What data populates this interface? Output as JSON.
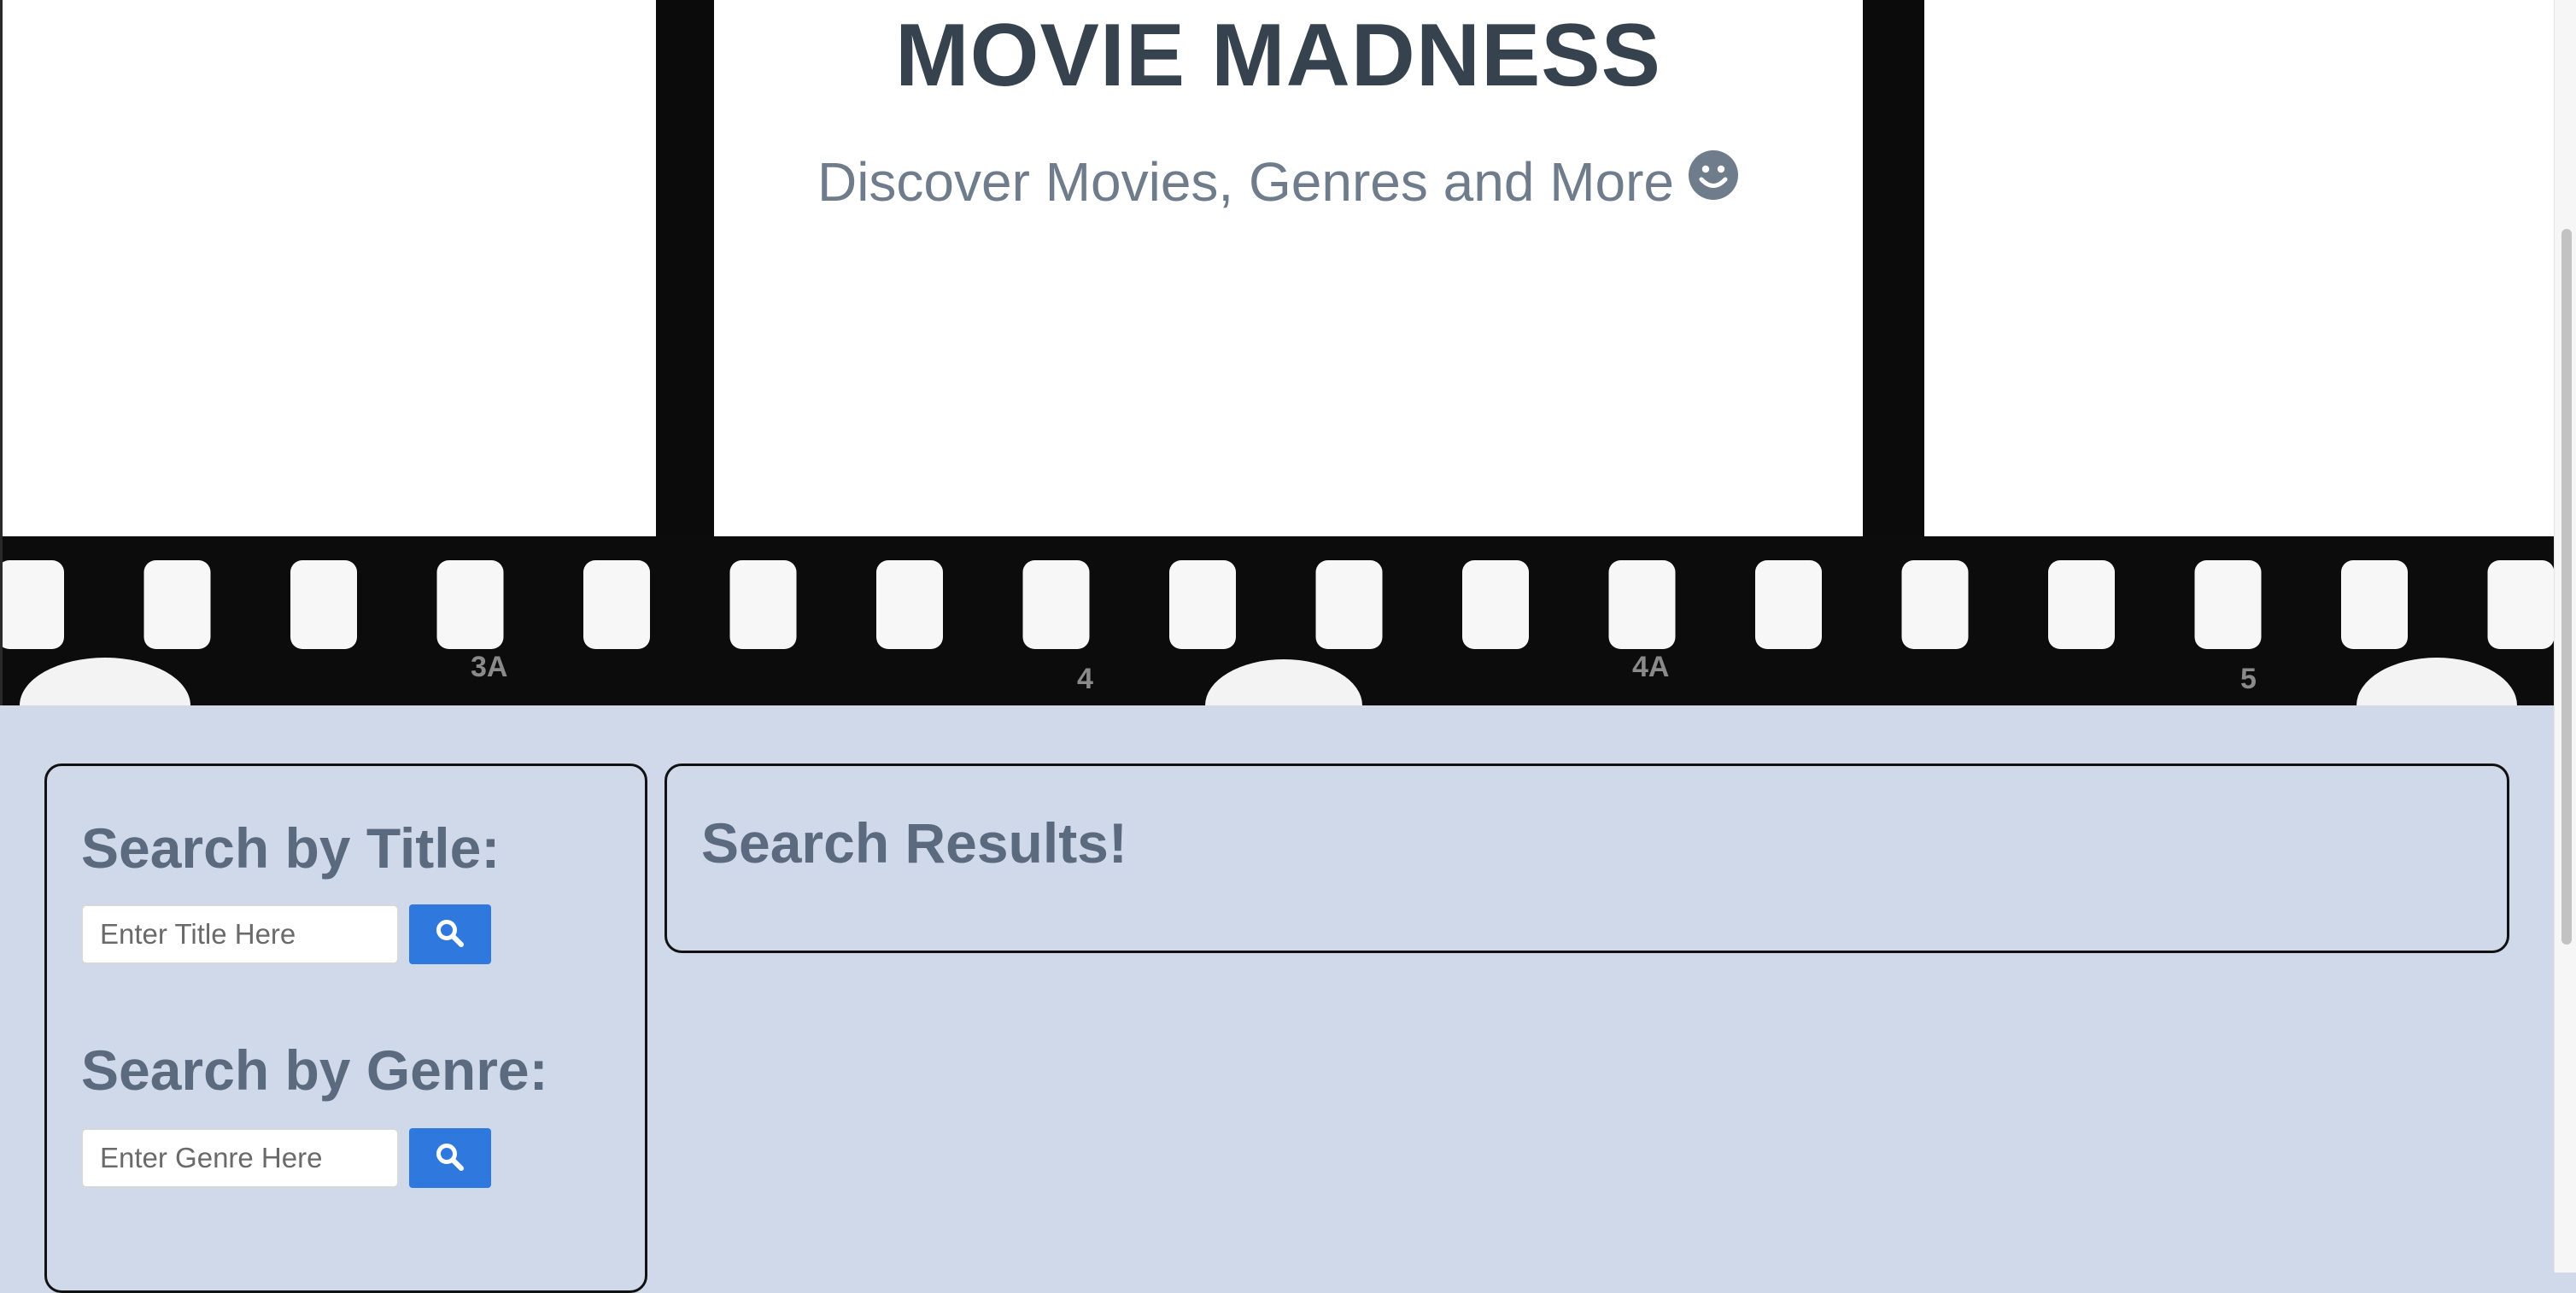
{
  "header": {
    "title": "MOVIE MADNESS",
    "subtitle": "Discover Movies, Genres and More"
  },
  "film_strip": {
    "frame_numbers": [
      "3A",
      "4",
      "4A",
      "5"
    ]
  },
  "search": {
    "title_heading": "Search by Title:",
    "title_placeholder": "Enter Title Here",
    "title_value": "",
    "genre_heading": "Search by Genre:",
    "genre_placeholder": "Enter Genre Here",
    "genre_value": "",
    "button_icon": "search-icon"
  },
  "results": {
    "heading": "Search Results!"
  },
  "colors": {
    "page_background": "#d0d9ea",
    "title": "#36434f",
    "subtitle": "#6f7c8c",
    "heading": "#5b6a7e",
    "button": "#2f78de",
    "panel_border": "#111111"
  }
}
